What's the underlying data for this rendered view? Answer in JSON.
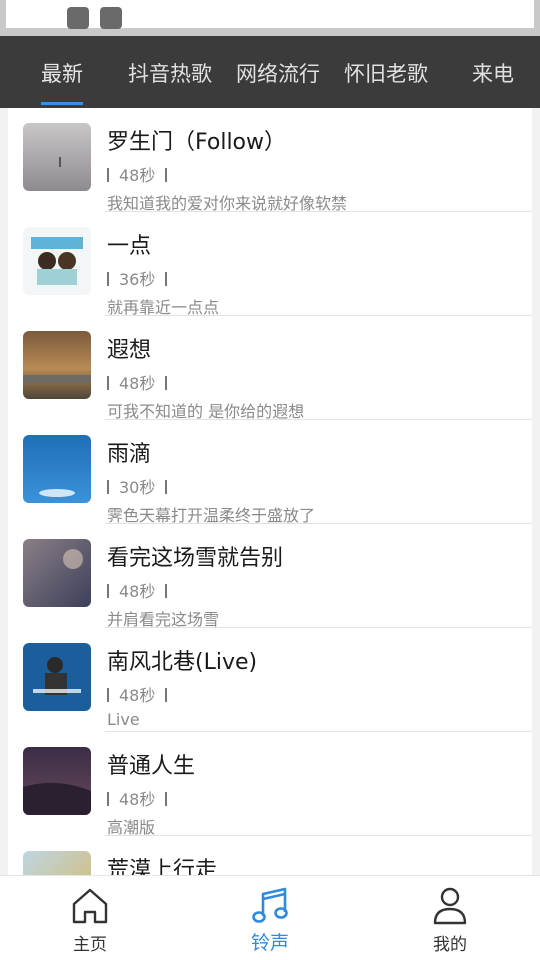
{
  "tabs": [
    {
      "label": "最新"
    },
    {
      "label": "抖音热歌"
    },
    {
      "label": "网络流行"
    },
    {
      "label": "怀旧老歌"
    },
    {
      "label": "来电"
    }
  ],
  "active_tab": "最新",
  "songs": [
    {
      "title": "罗生门（Follow）",
      "duration": "48秒",
      "desc": "我知道我的爱对你来说就好像软禁"
    },
    {
      "title": "一点",
      "duration": "36秒",
      "desc": "就再靠近一点点"
    },
    {
      "title": "遐想",
      "duration": "48秒",
      "desc": "可我不知道的 是你给的遐想"
    },
    {
      "title": "雨滴",
      "duration": "30秒",
      "desc": "霁色天幕打开温柔终于盛放了"
    },
    {
      "title": "看完这场雪就告别",
      "duration": "48秒",
      "desc": "并肩看完这场雪"
    },
    {
      "title": "南风北巷(Live)",
      "duration": "48秒",
      "desc": "Live"
    },
    {
      "title": "普通人生",
      "duration": "48秒",
      "desc": "高潮版"
    },
    {
      "title": "荒漠上行走",
      "duration": "",
      "desc": ""
    }
  ],
  "bottom_nav": [
    {
      "label": "主页",
      "icon": "home-icon"
    },
    {
      "label": "铃声",
      "icon": "music-note-icon"
    },
    {
      "label": "我的",
      "icon": "user-icon"
    }
  ],
  "colors": {
    "accent": "#2f8ae0",
    "tab_bar": "#3b3b3b"
  }
}
